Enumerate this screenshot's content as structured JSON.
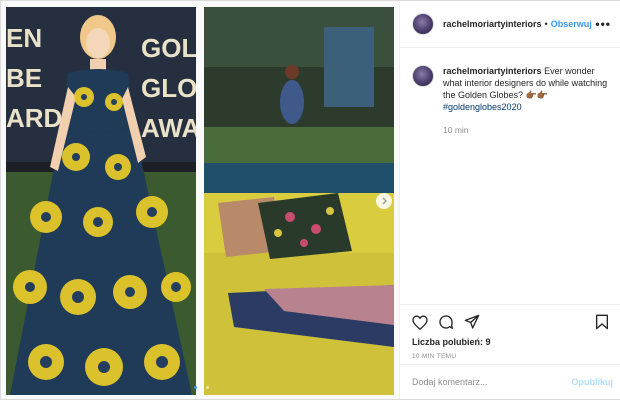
{
  "post": {
    "author": "rachelmoriartyinteriors",
    "follow_label": "Obserwuj",
    "header_separator": "•",
    "more_label": "•••"
  },
  "caption": {
    "username": "rachelmoriartyinteriors",
    "text": "Ever wonder what interior designers do while watching the Golden Globes?",
    "emojis": "👉🏾👉🏾",
    "hashtag": "#goldenglobes2020",
    "time": "10 min"
  },
  "media": {
    "left_photo_text": "GOLDEN GLOBES",
    "left_bg_letters_1": "EN",
    "left_bg_letters_2": "BE",
    "left_bg_letters_3": "ARDS",
    "right_bg_letters_1": "GOL",
    "right_bg_letters_2": "GLOB",
    "right_bg_letters_3": "AWA",
    "slides": 3,
    "active_slide": 1
  },
  "actions": {
    "likes_label": "Liczba polubień:",
    "likes_count": "9",
    "timestamp": "10 MIN TEMU"
  },
  "comment": {
    "placeholder": "Dodaj komentarz...",
    "publish_label": "Opublikuj"
  },
  "colors": {
    "accent": "#3897f0",
    "link": "#00376b",
    "muted": "#8e8e8e",
    "publish_disabled": "#b2dffc",
    "border": "#efefef"
  }
}
